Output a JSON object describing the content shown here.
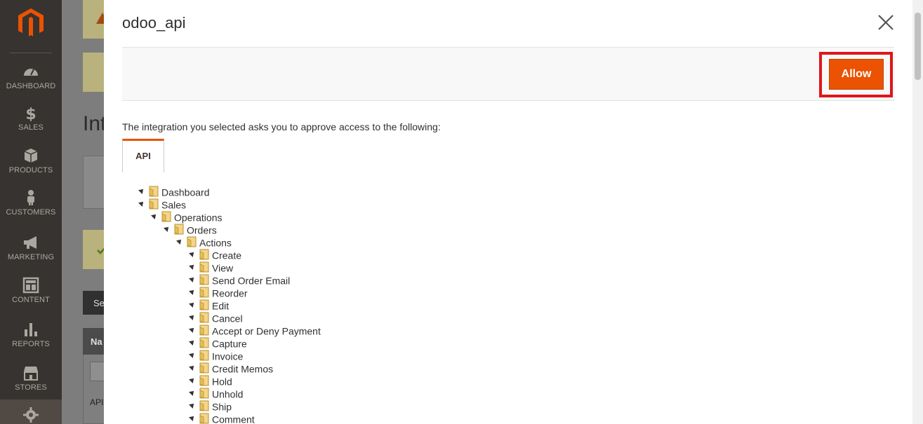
{
  "sidebar": {
    "items": [
      {
        "label": "DASHBOARD",
        "icon": "dashboard-gauge-icon"
      },
      {
        "label": "SALES",
        "icon": "dollar-icon"
      },
      {
        "label": "PRODUCTS",
        "icon": "box-icon"
      },
      {
        "label": "CUSTOMERS",
        "icon": "person-icon"
      },
      {
        "label": "MARKETING",
        "icon": "megaphone-icon"
      },
      {
        "label": "CONTENT",
        "icon": "content-layout-icon"
      },
      {
        "label": "REPORTS",
        "icon": "bar-chart-icon"
      },
      {
        "label": "STORES",
        "icon": "storefront-icon"
      },
      {
        "label": "",
        "icon": "gear-icon"
      }
    ]
  },
  "background": {
    "title_fragment": "Int",
    "button_fragment": "Se",
    "grid_header_fragment": "Na",
    "row_fragment": "API"
  },
  "modal": {
    "title": "odoo_api",
    "allow_label": "Allow",
    "intro": "The integration you selected asks you to approve access to the following:",
    "tab_label": "API",
    "tree": [
      {
        "label": "Dashboard",
        "level": 0
      },
      {
        "label": "Sales",
        "level": 0
      },
      {
        "label": "Operations",
        "level": 1
      },
      {
        "label": "Orders",
        "level": 2
      },
      {
        "label": "Actions",
        "level": 3
      },
      {
        "label": "Create",
        "level": 4
      },
      {
        "label": "View",
        "level": 4
      },
      {
        "label": "Send Order Email",
        "level": 4
      },
      {
        "label": "Reorder",
        "level": 4
      },
      {
        "label": "Edit",
        "level": 4
      },
      {
        "label": "Cancel",
        "level": 4
      },
      {
        "label": "Accept or Deny Payment",
        "level": 4
      },
      {
        "label": "Capture",
        "level": 4
      },
      {
        "label": "Invoice",
        "level": 4
      },
      {
        "label": "Credit Memos",
        "level": 4
      },
      {
        "label": "Hold",
        "level": 4
      },
      {
        "label": "Unhold",
        "level": 4
      },
      {
        "label": "Ship",
        "level": 4
      },
      {
        "label": "Comment",
        "level": 4
      }
    ]
  },
  "colors": {
    "accent": "#eb5202",
    "highlight_outline": "#e0151b",
    "sidebar_bg": "#373330"
  }
}
